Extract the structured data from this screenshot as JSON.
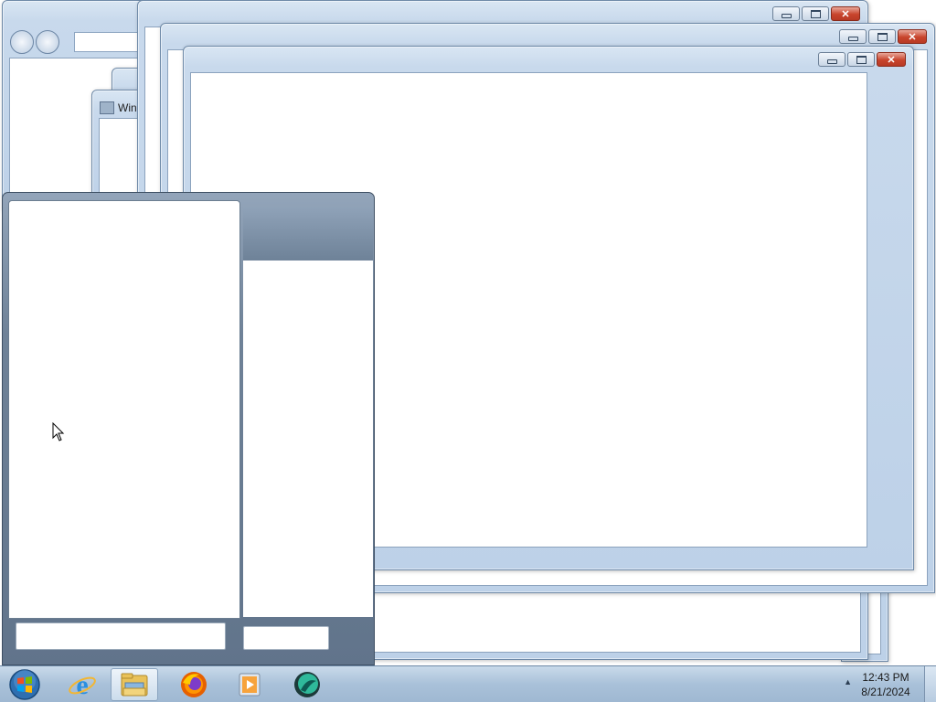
{
  "background_window": {
    "title_partial": "Win"
  },
  "windows": [
    {
      "id": "window-1"
    },
    {
      "id": "window-2"
    },
    {
      "id": "window-3"
    },
    {
      "id": "window-4"
    }
  ],
  "start_menu": {
    "search_placeholder": "",
    "shutdown_label": ""
  },
  "taskbar": {
    "start_icon": "windows-orb-icon",
    "pinned": [
      {
        "name": "internet-explorer",
        "icon": "internet-explorer-icon"
      },
      {
        "name": "windows-explorer",
        "icon": "folder-icon",
        "active": true
      },
      {
        "name": "firefox",
        "icon": "firefox-icon"
      },
      {
        "name": "media-player",
        "icon": "media-player-icon"
      },
      {
        "name": "app",
        "icon": "green-circle-app-icon"
      }
    ],
    "clock": {
      "time": "12:43 PM",
      "date": "8/21/2024"
    }
  },
  "colors": {
    "window_frame": "#c8d9ec",
    "close_button": "#c8442c",
    "taskbar": "#a9c1d9",
    "start_menu_frame": "#6f8298"
  }
}
